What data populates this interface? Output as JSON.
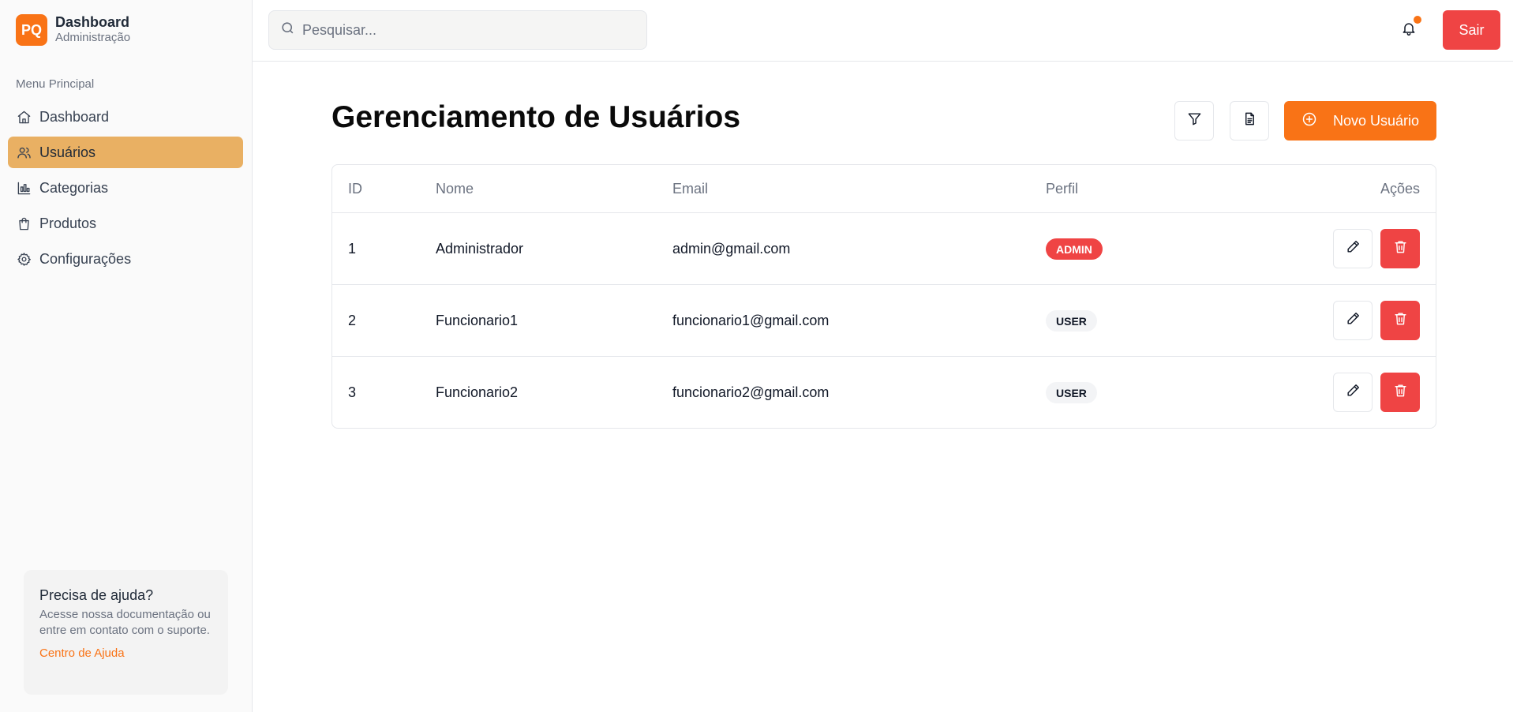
{
  "brand": {
    "logo_text": "PQ",
    "title": "Dashboard",
    "subtitle": "Administração"
  },
  "sidebar": {
    "heading": "Menu Principal",
    "items": [
      {
        "label": "Dashboard",
        "icon": "home-icon",
        "active": false
      },
      {
        "label": "Usuários",
        "icon": "users-icon",
        "active": true
      },
      {
        "label": "Categorias",
        "icon": "chart-icon",
        "active": false
      },
      {
        "label": "Produtos",
        "icon": "shopping-bag-icon",
        "active": false
      },
      {
        "label": "Configurações",
        "icon": "gear-icon",
        "active": false
      }
    ],
    "help": {
      "title": "Precisa de ajuda?",
      "text": "Acesse nossa documentação ou entre em contato com o suporte.",
      "link": "Centro de Ajuda"
    }
  },
  "topbar": {
    "search_placeholder": "Pesquisar...",
    "search_value": "",
    "notification_dot": true,
    "logout_label": "Sair"
  },
  "main": {
    "title": "Gerenciamento de Usuários",
    "new_user_label": "Novo Usuário",
    "table": {
      "headers": {
        "id": "ID",
        "name": "Nome",
        "email": "Email",
        "role": "Perfil",
        "actions": "Ações"
      },
      "rows": [
        {
          "id": "1",
          "name": "Administrador",
          "email": "admin@gmail.com",
          "role": "ADMIN"
        },
        {
          "id": "2",
          "name": "Funcionario1",
          "email": "funcionario1@gmail.com",
          "role": "USER"
        },
        {
          "id": "3",
          "name": "Funcionario2",
          "email": "funcionario2@gmail.com",
          "role": "USER"
        }
      ]
    }
  },
  "colors": {
    "accent": "#f97316",
    "active_nav": "#e9b063",
    "danger": "#ef4444"
  }
}
